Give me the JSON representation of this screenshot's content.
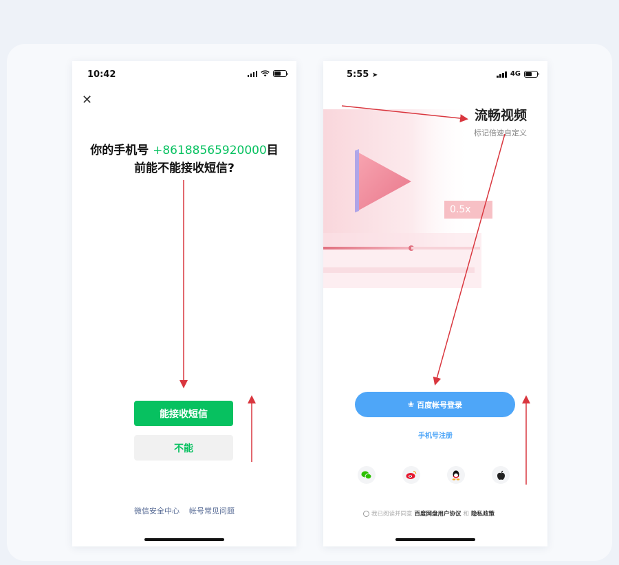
{
  "left_phone": {
    "status_time": "10:42",
    "question_prefix": "你的手机号 ",
    "phone_number": "+86188565920000",
    "question_suffix": "目前能不能接收短信?",
    "accept_button": "能接收短信",
    "cannot_button": "不能",
    "footer_links": [
      "微信安全中心",
      "帐号常见问题"
    ],
    "accent_color": "#07c160"
  },
  "right_phone": {
    "status_time": "5:55",
    "network": "4G",
    "title": "流畅视频",
    "subtitle": "标记倍速自定义",
    "speed_label": "0.5x",
    "baidu_login_button": "百度帐号登录",
    "phone_register_link": "手机号注册",
    "social_logins": [
      "wechat-icon",
      "weibo-icon",
      "qq-icon",
      "apple-icon"
    ],
    "agreement_prefix": "我已阅读并同意",
    "agreement_link1": "百度网盘用户协议",
    "agreement_and": "和",
    "agreement_link2": "隐私政策",
    "accent_color": "#4ea6f8"
  },
  "annotation_color": "#d9363e"
}
